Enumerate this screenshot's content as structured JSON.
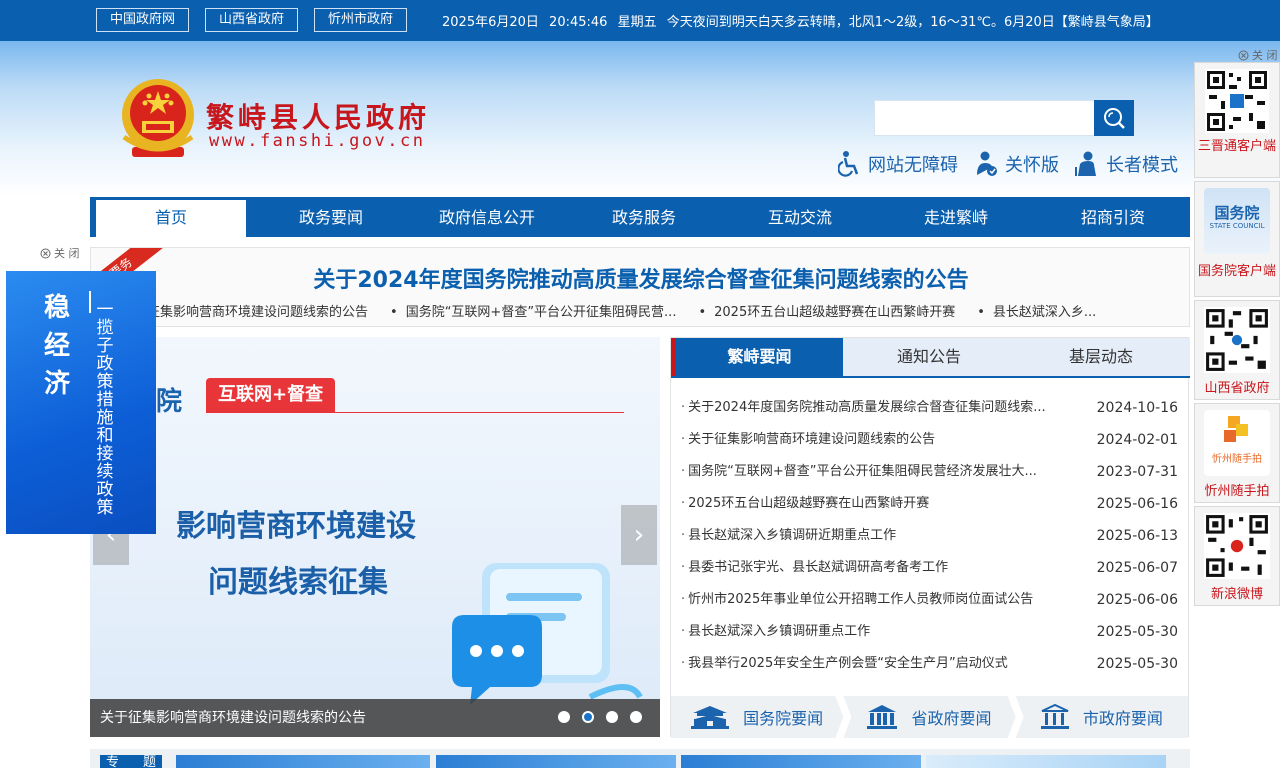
{
  "topbar": {
    "links": [
      "中国政府网",
      "山西省政府",
      "忻州市政府"
    ],
    "datetime": "2025年6月20日",
    "time": "20:45:46",
    "weekday": "星期五",
    "weather": "今天夜间到明天白天多云转晴，北风1～2级，16～31℃。6月20日【繁峙县气象局】"
  },
  "header": {
    "site_title": "繁峙县人民政府",
    "site_url": "www.fanshi.gov.cn",
    "search_placeholder": "",
    "access": [
      "网站无障碍",
      "关怀版",
      "长者模式"
    ]
  },
  "nav": [
    "首页",
    "政务要闻",
    "政府信息公开",
    "政务服务",
    "互动交流",
    "走进繁峙",
    "招商引资"
  ],
  "headline": {
    "ribbon": "要务",
    "title": "关于2024年度国务院推动高质量发展综合督查征集问题线索的公告",
    "ticker": [
      "征集影响营商环境建设问题线索的公告",
      "国务院“互联网+督查”平台公开征集阻碍民营...",
      "2025环五台山超级越野赛在山西繁峙开赛",
      "县长赵斌深入乡..."
    ]
  },
  "slider": {
    "brand": "务院",
    "tag": "互联网+督查",
    "line1": "影响营商环境建设",
    "line2": "问题线索征集",
    "caption": "关于征集影响营商环境建设问题线索的公告",
    "dots": 4,
    "active_dot": 2
  },
  "news": {
    "tabs": [
      "繁峙要闻",
      "通知公告",
      "基层动态"
    ],
    "items": [
      {
        "title": "关于2024年度国务院推动高质量发展综合督查征集问题线索...",
        "date": "2024-10-16"
      },
      {
        "title": "关于征集影响营商环境建设问题线索的公告",
        "date": "2024-02-01"
      },
      {
        "title": "国务院“互联网+督查”平台公开征集阻碍民营经济发展壮大...",
        "date": "2023-07-31"
      },
      {
        "title": "2025环五台山超级越野赛在山西繁峙开赛",
        "date": "2025-06-16"
      },
      {
        "title": "县长赵斌深入乡镇调研近期重点工作",
        "date": "2025-06-13"
      },
      {
        "title": "县委书记张宇光、县长赵斌调研高考备考工作",
        "date": "2025-06-07"
      },
      {
        "title": "忻州市2025年事业单位公开招聘工作人员教师岗位面试公告",
        "date": "2025-06-06"
      },
      {
        "title": "县长赵斌深入乡镇调研重点工作",
        "date": "2025-05-30"
      },
      {
        "title": "我县举行2025年安全生产例会暨“安全生产月”启动仪式",
        "date": "2025-05-30"
      }
    ],
    "gov_links": [
      "国务院要闻",
      "省政府要闻",
      "市政府要闻"
    ]
  },
  "bottom": {
    "label_left": "专",
    "label_right": "题"
  },
  "left_ad": {
    "close": "关 闭",
    "title": "稳经济",
    "subtitle": "一揽子政策措施和接续政策"
  },
  "right_float": {
    "close": "关 闭",
    "cards": [
      "三晋通客户端",
      "国务院客户端",
      "山西省政府",
      "忻州随手拍",
      "新浪微博"
    ],
    "state_council_text": "国务院",
    "state_council_sub": "STATE COUNCIL",
    "suishoupai_text": "忻州随手拍"
  },
  "colors": {
    "primary": "#0a5fae",
    "accent_red": "#c8161d",
    "ticker_bg": "#fafafa"
  }
}
